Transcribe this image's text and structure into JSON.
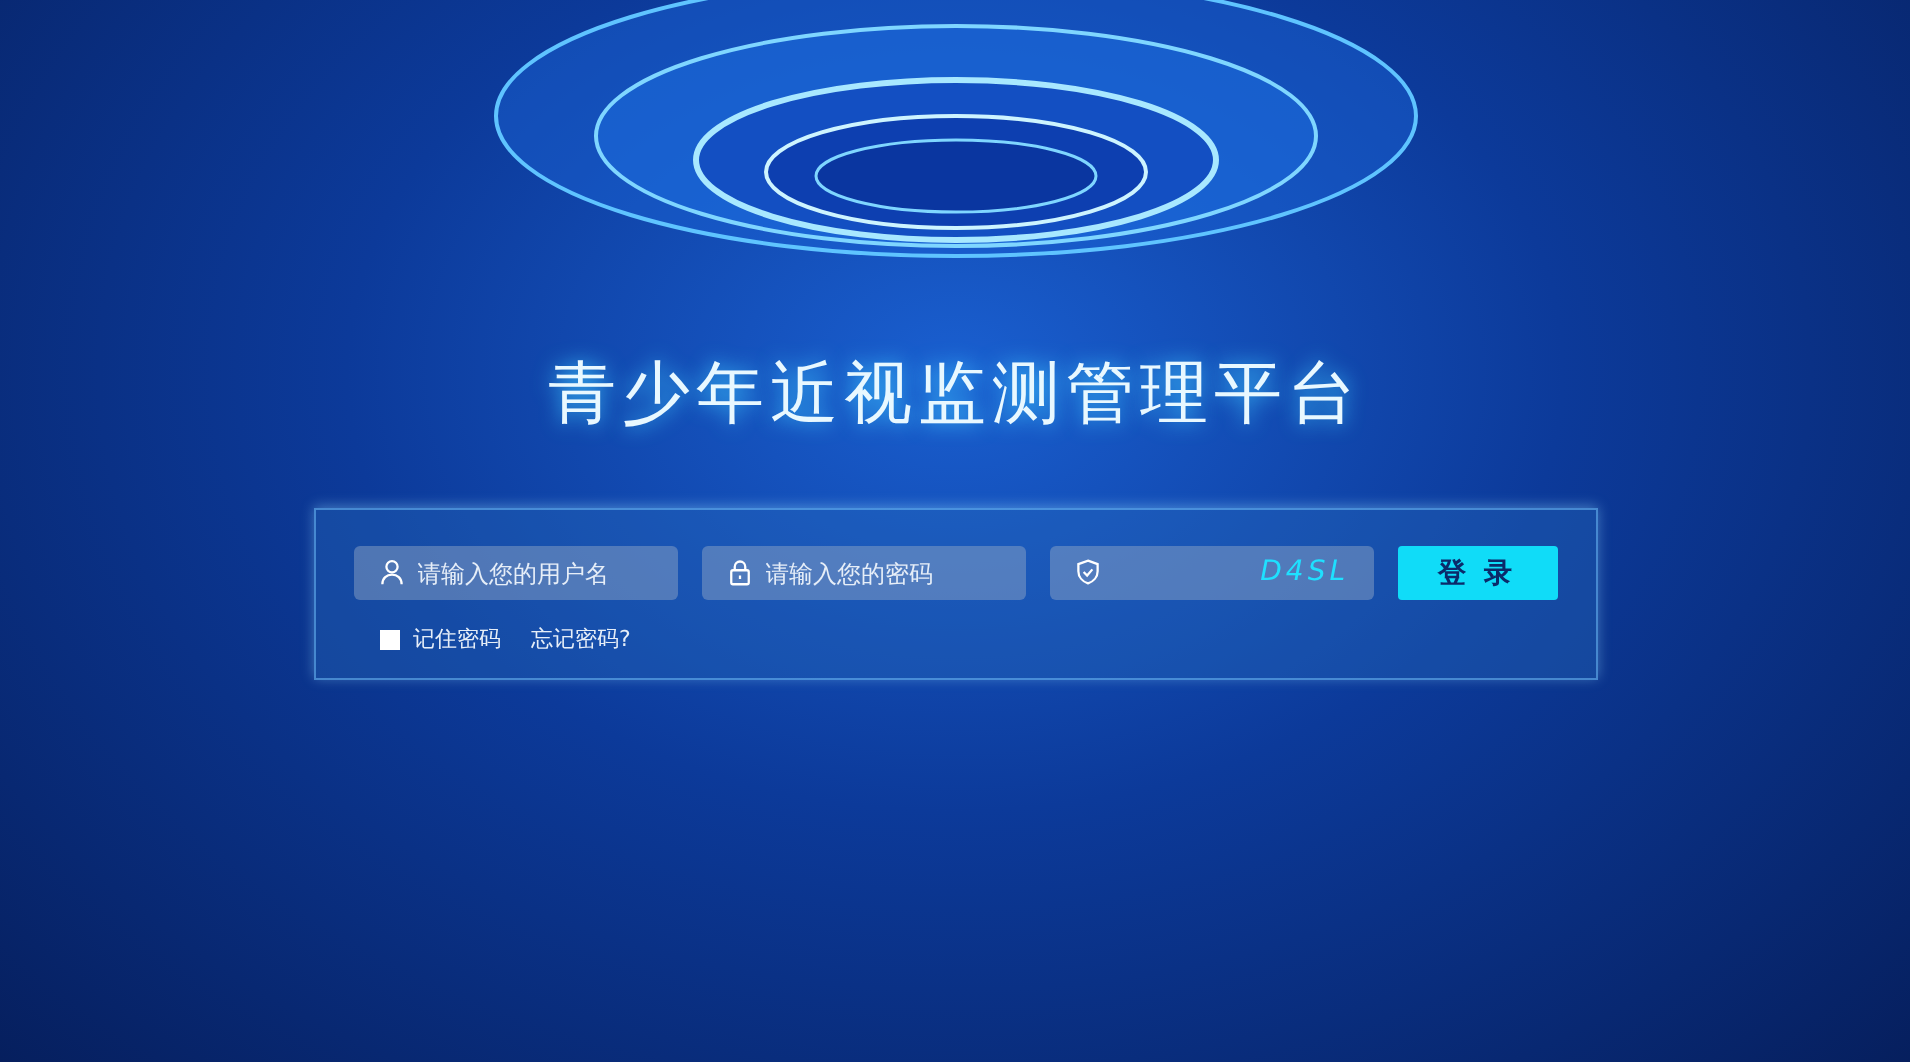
{
  "title": "青少年近视监测管理平台",
  "login_form": {
    "username": {
      "placeholder": "请输入您的用户名"
    },
    "password": {
      "placeholder": "请输入您的密码"
    },
    "captcha": {
      "code": "D4SL"
    },
    "submit_button": "登 录",
    "remember": {
      "label": "记住密码",
      "checked": false
    },
    "forgot_link": "忘记密码?"
  }
}
